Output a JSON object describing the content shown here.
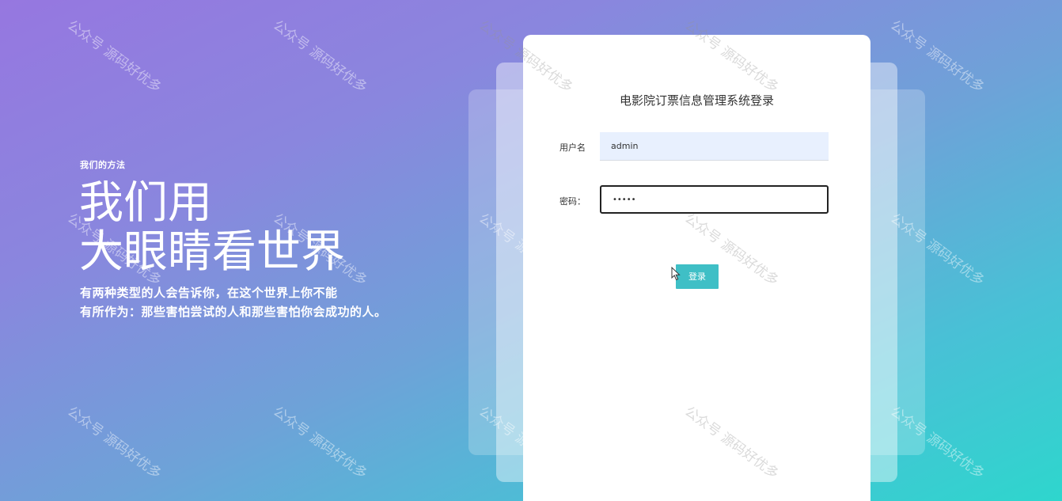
{
  "hero": {
    "kicker": "我们的方法",
    "title_line1": "我们用",
    "title_line2": "大眼睛看世界",
    "desc_line1": "有两种类型的人会告诉你，在这个世界上你不能",
    "desc_line2": "有所作为：那些害怕尝试的人和那些害怕你会成功的人。"
  },
  "login": {
    "title": "电影院订票信息管理系统登录",
    "username_label": "用户名",
    "username_value": "admin",
    "password_label": "密码：",
    "password_value": "•••••",
    "submit_label": "登录"
  },
  "watermark": {
    "text": "公众号 源码好优多"
  },
  "colors": {
    "accent": "#3fbfc6",
    "gradient_start": "#9677e0",
    "gradient_end": "#2ed6cd",
    "autofill_bg": "#e8f0fe"
  }
}
